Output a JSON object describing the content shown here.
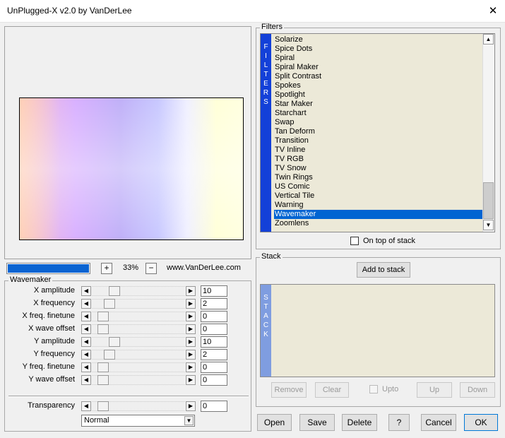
{
  "window": {
    "title": "UnPlugged-X v2.0 by VanDerLee",
    "close_glyph": "✕"
  },
  "preview": {
    "progress": 1.0,
    "zoom_in": "+",
    "zoom_out": "−",
    "zoom_value": "33%",
    "website": "www.VanDerLee.com"
  },
  "wavemaker": {
    "group_label": "Wavemaker",
    "params": [
      {
        "label": "X amplitude",
        "value": "10",
        "level": 0.14
      },
      {
        "label": "X frequency",
        "value": "2",
        "level": 0.08
      },
      {
        "label": "X freq. finetune",
        "value": "0",
        "level": 0.0
      },
      {
        "label": "X wave offset",
        "value": "0",
        "level": 0.0
      },
      {
        "label": "Y amplitude",
        "value": "10",
        "level": 0.14
      },
      {
        "label": "Y frequency",
        "value": "2",
        "level": 0.08
      },
      {
        "label": "Y freq. finetune",
        "value": "0",
        "level": 0.0
      },
      {
        "label": "Y wave offset",
        "value": "0",
        "level": 0.0
      }
    ],
    "transparency": {
      "label": "Transparency",
      "value": "0",
      "level": 0.0
    },
    "blend_mode": "Normal"
  },
  "filters": {
    "group_label": "Filters",
    "side_label": "FILTERS",
    "items": [
      "Solarize",
      "Spice Dots",
      "Spiral",
      "Spiral Maker",
      "Split Contrast",
      "Spokes",
      "Spotlight",
      "Star Maker",
      "Starchart",
      "Swap",
      "Tan Deform",
      "Transition",
      "TV Inline",
      "TV RGB",
      "TV Snow",
      "Twin Rings",
      "US Comic",
      "Vertical Tile",
      "Warning",
      "Wavemaker",
      "Zoomlens"
    ],
    "selected_index": 19,
    "on_top_label": "On top of stack"
  },
  "stack": {
    "group_label": "Stack",
    "side_label": "STACK",
    "add_label": "Add to stack",
    "remove_label": "Remove",
    "clear_label": "Clear",
    "upto_label": "Upto",
    "up_label": "Up",
    "down_label": "Down"
  },
  "footer": {
    "open": "Open",
    "save": "Save",
    "delete": "Delete",
    "help": "?",
    "cancel": "Cancel",
    "ok": "OK"
  },
  "colors": {
    "accent": "#0064d2",
    "filters_bar": "#1340d8",
    "stack_bar": "#7f9de0",
    "list_bg": "#ece9d8"
  },
  "icons": {
    "close": "close-icon",
    "arrow_left": "arrow-left-icon",
    "arrow_right": "arrow-right-icon",
    "arrow_up": "arrow-up-icon",
    "arrow_down": "arrow-down-icon",
    "dropdown": "chevron-down-icon"
  }
}
